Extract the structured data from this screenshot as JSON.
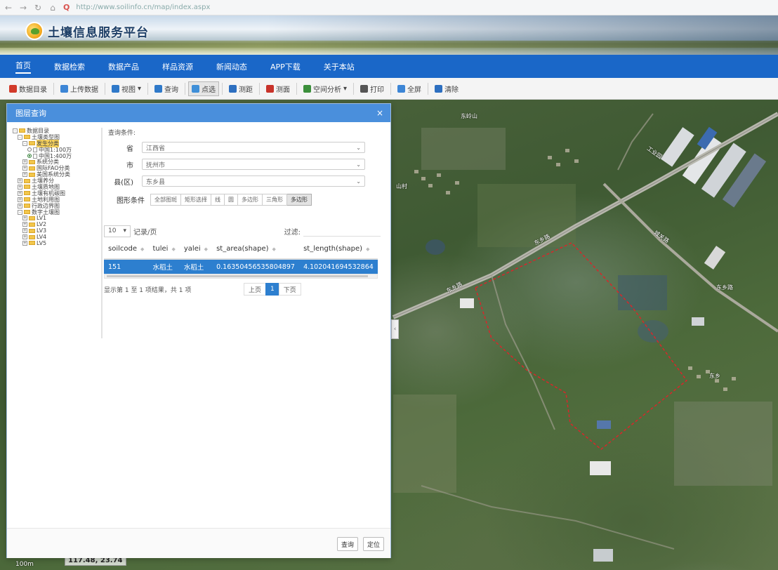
{
  "browser": {
    "url": "http://www.soilinfo.cn/map/index.aspx"
  },
  "header": {
    "site_title": "土壤信息服务平台"
  },
  "nav": [
    "首页",
    "数据检索",
    "数据产品",
    "样品资源",
    "新闻动态",
    "APP下载",
    "关于本站"
  ],
  "toolbar": [
    {
      "label": "数据目录",
      "color": "#d23a2a"
    },
    {
      "label": "上传数据",
      "color": "#3d86d6"
    },
    {
      "label": "视图",
      "color": "#2f79c9",
      "dropdown": true
    },
    {
      "label": "查询",
      "color": "#2f79c9"
    },
    {
      "label": "点选",
      "color": "#3f8fd8",
      "pressed": true
    },
    {
      "label": "测距",
      "color": "#2d6fc0"
    },
    {
      "label": "测面",
      "color": "#c8322a"
    },
    {
      "label": "空间分析",
      "color": "#3b8f3b",
      "dropdown": true
    },
    {
      "label": "打印",
      "color": "#555555"
    },
    {
      "label": "全屏",
      "color": "#3d86d6"
    },
    {
      "label": "清除",
      "color": "#2d6fc0"
    }
  ],
  "panel": {
    "title": "图层查询",
    "tree": [
      {
        "label": "数据目录",
        "level": 0,
        "toggle": "-",
        "type": "folder"
      },
      {
        "label": "土壤类型图",
        "level": 1,
        "toggle": "-",
        "type": "folder"
      },
      {
        "label": "发生分类",
        "level": 2,
        "toggle": "-",
        "type": "folder",
        "selected": true
      },
      {
        "label": "中国1:100万",
        "level": 3,
        "type": "radio"
      },
      {
        "label": "中国1:400万",
        "level": 3,
        "type": "radio",
        "checked": true
      },
      {
        "label": "系统分类",
        "level": 2,
        "toggle": "+",
        "type": "folder"
      },
      {
        "label": "国际FAO分类",
        "level": 2,
        "toggle": "+",
        "type": "folder"
      },
      {
        "label": "美国系统分类",
        "level": 2,
        "toggle": "+",
        "type": "folder"
      },
      {
        "label": "土壤养分",
        "level": 1,
        "toggle": "+",
        "type": "folder"
      },
      {
        "label": "土壤质地图",
        "level": 1,
        "toggle": "+",
        "type": "folder"
      },
      {
        "label": "土壤有机碳图",
        "level": 1,
        "toggle": "+",
        "type": "folder"
      },
      {
        "label": "土地利用图",
        "level": 1,
        "toggle": "+",
        "type": "folder"
      },
      {
        "label": "行政边界图",
        "level": 1,
        "toggle": "+",
        "type": "folder"
      },
      {
        "label": "数字土壤图",
        "level": 1,
        "toggle": "-",
        "type": "folder"
      },
      {
        "label": "LV1",
        "level": 2,
        "toggle": "+",
        "type": "folder"
      },
      {
        "label": "LV2",
        "level": 2,
        "toggle": "+",
        "type": "folder"
      },
      {
        "label": "LV3",
        "level": 2,
        "toggle": "+",
        "type": "folder"
      },
      {
        "label": "LV4",
        "level": 2,
        "toggle": "+",
        "type": "folder"
      },
      {
        "label": "LV5",
        "level": 2,
        "toggle": "+",
        "type": "folder"
      }
    ],
    "conditions_title": "查询条件:",
    "province_label": "省",
    "province_value": "江西省",
    "city_label": "市",
    "city_value": "抚州市",
    "county_label": "县(区)",
    "county_value": "东乡县",
    "shape_label": "图形条件",
    "shape_buttons": [
      "全部图斑",
      "矩形选择",
      "线",
      "圆",
      "多边形",
      "三角形",
      "多边形"
    ],
    "shape_active_index": 6,
    "page_size": "10",
    "page_size_suffix": "记录/页",
    "filter_label": "过滤:",
    "columns": [
      "soilcode",
      "tulei",
      "yalei",
      "st_area(shape)",
      "st_length(shape)"
    ],
    "rows": [
      [
        "151",
        "水稻土",
        "水稻土",
        "0.16350456535804897",
        "4.102041694532864"
      ]
    ],
    "info_text": "显示第 1 至 1 项结果，共 1 项",
    "pager": {
      "prev": "上页",
      "current": "1",
      "next": "下页"
    },
    "query_button": "查询",
    "locate_button": "定位"
  },
  "map": {
    "scale": "100m",
    "coordinates": "117.48, 23.74",
    "labels": [
      "东岭山",
      "山村",
      "工业园",
      "城关路",
      "东乡路",
      "东乡路",
      "东乡路",
      "东乡"
    ]
  }
}
